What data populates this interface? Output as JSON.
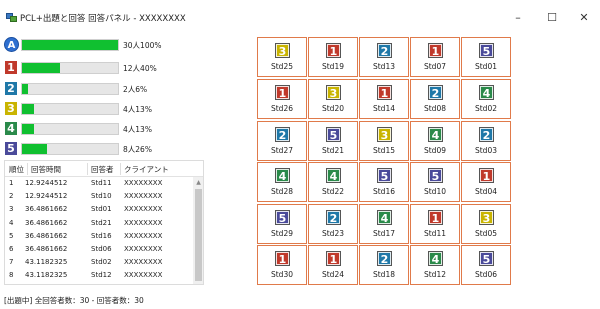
{
  "window": {
    "title": "PCL+出題と回答 回答パネル - XXXXXXXX",
    "minimize": "–",
    "maximize": "☐",
    "close": "✕"
  },
  "colors": {
    "c1": "#c0392b",
    "c2": "#1f78a8",
    "c3": "#c9b400",
    "c4": "#2a8a4a",
    "c5": "#4a4a9a",
    "cA": "#2e6fd0",
    "bar": "#10c030",
    "card_border": "#e07a4a"
  },
  "results": [
    {
      "key": "A",
      "label": "30人100%",
      "fraction": 1.0,
      "color": "cA"
    },
    {
      "key": "1",
      "label": "12人40%",
      "fraction": 0.4,
      "color": "c1"
    },
    {
      "key": "2",
      "label": "2人6%",
      "fraction": 0.06,
      "color": "c2"
    },
    {
      "key": "3",
      "label": "4人13%",
      "fraction": 0.13,
      "color": "c3"
    },
    {
      "key": "4",
      "label": "4人13%",
      "fraction": 0.13,
      "color": "c4"
    },
    {
      "key": "5",
      "label": "8人26%",
      "fraction": 0.26,
      "color": "c5"
    }
  ],
  "table": {
    "headers": [
      "順位",
      "回答時間",
      "回答者",
      "クライアント"
    ],
    "rows": [
      [
        "1",
        "12.9244512",
        "Std11",
        "XXXXXXXX"
      ],
      [
        "2",
        "12.9244512",
        "Std10",
        "XXXXXXXX"
      ],
      [
        "3",
        "36.4861662",
        "Std01",
        "XXXXXXXX"
      ],
      [
        "4",
        "36.4861662",
        "Std21",
        "XXXXXXXX"
      ],
      [
        "5",
        "36.4861662",
        "Std16",
        "XXXXXXXX"
      ],
      [
        "6",
        "36.4861662",
        "Std06",
        "XXXXXXXX"
      ],
      [
        "7",
        "43.1182325",
        "Std02",
        "XXXXXXXX"
      ],
      [
        "8",
        "43.1182325",
        "Std12",
        "XXXXXXXX"
      ]
    ]
  },
  "status": "[出題中] 全回答者数：30 - 回答者数：30",
  "cards": [
    [
      {
        "n": "3",
        "c": "c3",
        "s": "Std25"
      },
      {
        "n": "1",
        "c": "c1",
        "s": "Std19"
      },
      {
        "n": "2",
        "c": "c2",
        "s": "Std13"
      },
      {
        "n": "1",
        "c": "c1",
        "s": "Std07"
      },
      {
        "n": "5",
        "c": "c5",
        "s": "Std01"
      }
    ],
    [
      {
        "n": "1",
        "c": "c1",
        "s": "Std26"
      },
      {
        "n": "3",
        "c": "c3",
        "s": "Std20"
      },
      {
        "n": "1",
        "c": "c1",
        "s": "Std14"
      },
      {
        "n": "2",
        "c": "c2",
        "s": "Std08"
      },
      {
        "n": "4",
        "c": "c4",
        "s": "Std02"
      }
    ],
    [
      {
        "n": "2",
        "c": "c2",
        "s": "Std27"
      },
      {
        "n": "5",
        "c": "c5",
        "s": "Std21"
      },
      {
        "n": "3",
        "c": "c3",
        "s": "Std15"
      },
      {
        "n": "4",
        "c": "c4",
        "s": "Std09"
      },
      {
        "n": "2",
        "c": "c2",
        "s": "Std03"
      }
    ],
    [
      {
        "n": "4",
        "c": "c4",
        "s": "Std28"
      },
      {
        "n": "4",
        "c": "c4",
        "s": "Std22"
      },
      {
        "n": "5",
        "c": "c5",
        "s": "Std16"
      },
      {
        "n": "5",
        "c": "c5",
        "s": "Std10"
      },
      {
        "n": "1",
        "c": "c1",
        "s": "Std04"
      }
    ],
    [
      {
        "n": "5",
        "c": "c5",
        "s": "Std29"
      },
      {
        "n": "2",
        "c": "c2",
        "s": "Std23"
      },
      {
        "n": "4",
        "c": "c4",
        "s": "Std17"
      },
      {
        "n": "1",
        "c": "c1",
        "s": "Std11"
      },
      {
        "n": "3",
        "c": "c3",
        "s": "Std05"
      }
    ],
    [
      {
        "n": "1",
        "c": "c1",
        "s": "Std30"
      },
      {
        "n": "1",
        "c": "c1",
        "s": "Std24"
      },
      {
        "n": "2",
        "c": "c2",
        "s": "Std18"
      },
      {
        "n": "4",
        "c": "c4",
        "s": "Std12"
      },
      {
        "n": "5",
        "c": "c5",
        "s": "Std06"
      }
    ]
  ]
}
